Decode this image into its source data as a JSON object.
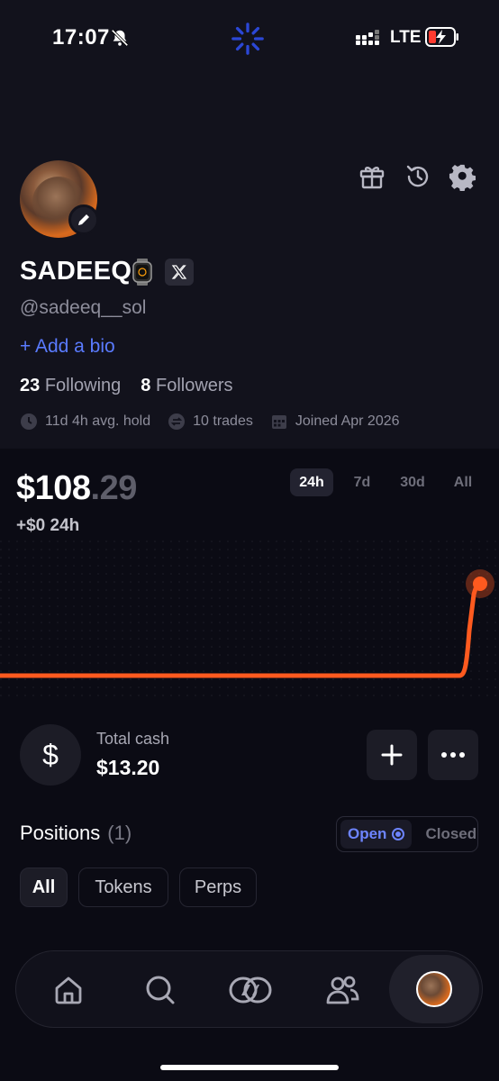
{
  "status_bar": {
    "time": "17:07",
    "network": "LTE"
  },
  "profile": {
    "name": "SADEEQ",
    "handle": "@sadeeq__sol",
    "add_bio_label": "+ Add a bio",
    "following_count": "23",
    "following_label": "Following",
    "followers_count": "8",
    "followers_label": "Followers",
    "stats": [
      {
        "icon": "clock-icon",
        "label": "11d 4h avg. hold"
      },
      {
        "icon": "swap-icon",
        "label": "10 trades"
      },
      {
        "icon": "calendar-icon",
        "label": "Joined Apr 2026"
      }
    ]
  },
  "top_actions": [
    {
      "icon": "gift-icon"
    },
    {
      "icon": "history-icon"
    },
    {
      "icon": "settings-icon"
    }
  ],
  "portfolio": {
    "balance_main": "$108",
    "balance_cents": ".29",
    "change": "+$0 24h",
    "range_tabs": [
      "24h",
      "7d",
      "30d",
      "All"
    ],
    "selected_range": "24h",
    "line_color": "#ff5a1f"
  },
  "chart_data": {
    "type": "line",
    "series": [
      {
        "values": [
          108.29,
          108.29,
          108.29,
          108.29,
          108.29,
          108.29,
          108.29,
          108.29,
          108.29,
          108.29,
          108.29,
          108.29
        ]
      }
    ],
    "title": "",
    "xlabel": "",
    "ylabel": ""
  },
  "cash": {
    "label": "Total cash",
    "value": "$13.20",
    "symbol": "$"
  },
  "positions": {
    "title": "Positions",
    "count": "(1)",
    "toggle_open": "Open",
    "toggle_closed": "Closed",
    "filters": [
      "All",
      "Tokens",
      "Perps"
    ],
    "selected_filter": "All"
  },
  "nav": [
    {
      "icon": "home-icon"
    },
    {
      "icon": "search-icon"
    },
    {
      "icon": "trade-icon"
    },
    {
      "icon": "community-icon"
    },
    {
      "icon": "profile-avatar"
    }
  ],
  "colors": {
    "accent": "#5a7bff",
    "chart_line": "#ff5a1f",
    "background": "#0b0b14"
  }
}
